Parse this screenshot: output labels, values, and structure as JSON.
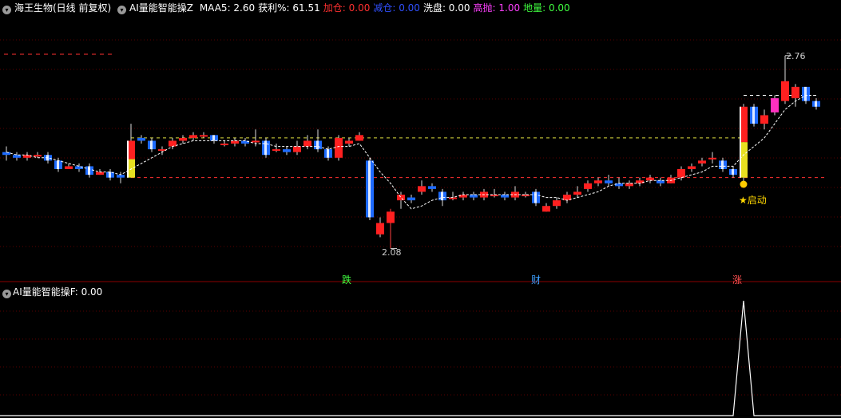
{
  "header": {
    "stock_title": "海王生物(日线 前复权)",
    "indicator_name": "AI量能智能操Z",
    "items": [
      {
        "label": "MAA5:",
        "value": "2.60",
        "color": "#ffffff"
      },
      {
        "label": "获利%:",
        "value": "61.51",
        "color": "#ffffff"
      },
      {
        "label": "加仓:",
        "value": "0.00",
        "color": "#ff3030"
      },
      {
        "label": "减仓:",
        "value": "0.00",
        "color": "#3050ff"
      },
      {
        "label": "洗盘:",
        "value": "0.00",
        "color": "#ffffff"
      },
      {
        "label": "高抛:",
        "value": "1.00",
        "color": "#ff40ff"
      },
      {
        "label": "地量:",
        "value": "0.00",
        "color": "#40ff40"
      }
    ]
  },
  "sub_header": {
    "indicator_name": "AI量能智能操F",
    "value": ": 0.00"
  },
  "labels": {
    "high": "2.76",
    "low": "2.08",
    "start": "启动",
    "signals": [
      {
        "text": "跌",
        "color": "#40ff40"
      },
      {
        "text": "财",
        "color": "#3da0ff"
      },
      {
        "text": "涨",
        "color": "#ff5050"
      }
    ]
  },
  "colors": {
    "up": "#ff2020",
    "down": "#1e6bff",
    "background": "#000000"
  },
  "chart_data": {
    "type": "candlestick",
    "title": "",
    "high_marker": 2.76,
    "low_marker": 2.08,
    "candles": [
      [
        2.42,
        2.41,
        2.44,
        2.39
      ],
      [
        2.41,
        2.4,
        2.42,
        2.39
      ],
      [
        2.4,
        2.41,
        2.42,
        2.39
      ],
      [
        2.41,
        2.41,
        2.42,
        2.4
      ],
      [
        2.41,
        2.39,
        2.42,
        2.38
      ],
      [
        2.39,
        2.36,
        2.4,
        2.35
      ],
      [
        2.36,
        2.37,
        2.38,
        2.36
      ],
      [
        2.37,
        2.36,
        2.38,
        2.35
      ],
      [
        2.37,
        2.34,
        2.38,
        2.33
      ],
      [
        2.34,
        2.35,
        2.36,
        2.34
      ],
      [
        2.35,
        2.33,
        2.36,
        2.32
      ],
      [
        2.34,
        2.33,
        2.35,
        2.31
      ],
      [
        2.33,
        2.46,
        2.52,
        2.33
      ],
      [
        2.47,
        2.46,
        2.48,
        2.45
      ],
      [
        2.46,
        2.43,
        2.47,
        2.42
      ],
      [
        2.43,
        2.43,
        2.44,
        2.41
      ],
      [
        2.44,
        2.46,
        2.47,
        2.43
      ],
      [
        2.46,
        2.47,
        2.48,
        2.45
      ],
      [
        2.47,
        2.48,
        2.49,
        2.46
      ],
      [
        2.48,
        2.48,
        2.49,
        2.47
      ],
      [
        2.48,
        2.46,
        2.48,
        2.45
      ],
      [
        2.45,
        2.45,
        2.46,
        2.44
      ],
      [
        2.45,
        2.46,
        2.47,
        2.44
      ],
      [
        2.46,
        2.45,
        2.47,
        2.44
      ],
      [
        2.46,
        2.46,
        2.5,
        2.44
      ],
      [
        2.46,
        2.41,
        2.47,
        2.4
      ],
      [
        2.43,
        2.43,
        2.45,
        2.42
      ],
      [
        2.43,
        2.42,
        2.44,
        2.41
      ],
      [
        2.42,
        2.44,
        2.46,
        2.41
      ],
      [
        2.44,
        2.46,
        2.48,
        2.43
      ],
      [
        2.46,
        2.43,
        2.5,
        2.42
      ],
      [
        2.43,
        2.4,
        2.44,
        2.39
      ],
      [
        2.4,
        2.47,
        2.48,
        2.39
      ],
      [
        2.45,
        2.46,
        2.47,
        2.44
      ],
      [
        2.46,
        2.48,
        2.49,
        2.46
      ],
      [
        2.39,
        2.19,
        2.4,
        2.18
      ],
      [
        2.13,
        2.17,
        2.19,
        2.12
      ],
      [
        2.17,
        2.21,
        2.22,
        2.08
      ],
      [
        2.25,
        2.27,
        2.28,
        2.22
      ],
      [
        2.26,
        2.25,
        2.27,
        2.24
      ],
      [
        2.28,
        2.3,
        2.32,
        2.27
      ],
      [
        2.3,
        2.29,
        2.31,
        2.28
      ],
      [
        2.28,
        2.25,
        2.29,
        2.23
      ],
      [
        2.26,
        2.26,
        2.28,
        2.25
      ],
      [
        2.26,
        2.27,
        2.28,
        2.25
      ],
      [
        2.27,
        2.26,
        2.28,
        2.25
      ],
      [
        2.26,
        2.28,
        2.29,
        2.25
      ],
      [
        2.27,
        2.27,
        2.29,
        2.26
      ],
      [
        2.27,
        2.26,
        2.28,
        2.25
      ],
      [
        2.26,
        2.28,
        2.3,
        2.25
      ],
      [
        2.27,
        2.27,
        2.28,
        2.26
      ],
      [
        2.28,
        2.24,
        2.29,
        2.23
      ],
      [
        2.21,
        2.23,
        2.24,
        2.21
      ],
      [
        2.23,
        2.25,
        2.26,
        2.22
      ],
      [
        2.25,
        2.27,
        2.28,
        2.24
      ],
      [
        2.27,
        2.28,
        2.3,
        2.26
      ],
      [
        2.29,
        2.31,
        2.32,
        2.28
      ],
      [
        2.31,
        2.32,
        2.33,
        2.3
      ],
      [
        2.32,
        2.31,
        2.34,
        2.3
      ],
      [
        2.31,
        2.3,
        2.33,
        2.29
      ],
      [
        2.3,
        2.31,
        2.32,
        2.29
      ],
      [
        2.31,
        2.32,
        2.33,
        2.3
      ],
      [
        2.32,
        2.33,
        2.34,
        2.31
      ],
      [
        2.32,
        2.31,
        2.33,
        2.3
      ],
      [
        2.31,
        2.33,
        2.34,
        2.31
      ],
      [
        2.33,
        2.36,
        2.37,
        2.32
      ],
      [
        2.36,
        2.37,
        2.38,
        2.35
      ],
      [
        2.38,
        2.39,
        2.4,
        2.37
      ],
      [
        2.4,
        2.4,
        2.42,
        2.38
      ],
      [
        2.39,
        2.36,
        2.4,
        2.35
      ],
      [
        2.36,
        2.34,
        2.37,
        2.33
      ],
      [
        2.33,
        2.58,
        2.59,
        2.31
      ],
      [
        2.58,
        2.52,
        2.59,
        2.51
      ],
      [
        2.52,
        2.55,
        2.57,
        2.5
      ],
      [
        2.56,
        2.61,
        2.62,
        2.55
      ],
      [
        2.6,
        2.67,
        2.76,
        2.59
      ],
      [
        2.61,
        2.65,
        2.66,
        2.58
      ],
      [
        2.65,
        2.6,
        2.64,
        2.59
      ],
      [
        2.6,
        2.58,
        2.61,
        2.57
      ]
    ],
    "ma": [
      2.42,
      2.41,
      2.41,
      2.4,
      2.4,
      2.39,
      2.38,
      2.37,
      2.36,
      2.35,
      2.35,
      2.34,
      2.36,
      2.38,
      2.4,
      2.42,
      2.44,
      2.45,
      2.46,
      2.46,
      2.46,
      2.46,
      2.46,
      2.46,
      2.45,
      2.45,
      2.44,
      2.44,
      2.44,
      2.44,
      2.44,
      2.43,
      2.44,
      2.44,
      2.45,
      2.4,
      2.35,
      2.31,
      2.26,
      2.22,
      2.23,
      2.25,
      2.26,
      2.26,
      2.27,
      2.27,
      2.27,
      2.27,
      2.27,
      2.27,
      2.27,
      2.27,
      2.26,
      2.26,
      2.25,
      2.26,
      2.27,
      2.28,
      2.3,
      2.31,
      2.31,
      2.31,
      2.32,
      2.32,
      2.32,
      2.33,
      2.34,
      2.35,
      2.37,
      2.37,
      2.37,
      2.41,
      2.44,
      2.47,
      2.52,
      2.57,
      2.6,
      2.62,
      2.62
    ],
    "h_lines": [
      {
        "value": 2.47,
        "color": "#e0e040"
      },
      {
        "value": 2.33,
        "color": "#ff3030"
      },
      {
        "value": 2.62,
        "color": "#ffffff"
      }
    ],
    "lower_panel": {
      "indicator": "AI量能智能操F",
      "values": [
        0,
        0,
        0,
        0,
        0,
        0,
        0,
        0,
        0,
        0,
        0,
        0,
        0,
        0,
        0,
        0,
        0,
        0,
        0,
        0,
        0,
        0,
        0,
        0,
        0,
        0,
        0,
        0,
        0,
        0,
        0,
        0,
        0,
        0,
        0,
        0,
        0,
        0,
        0,
        0,
        0,
        0,
        0,
        0,
        0,
        0,
        0,
        0,
        0,
        0,
        0,
        0,
        0,
        0,
        0,
        0,
        0,
        0,
        0,
        0,
        0,
        0,
        0,
        0,
        0,
        0,
        0,
        0,
        0,
        0,
        0,
        1,
        0,
        0,
        0,
        0,
        0,
        0,
        0
      ],
      "ylim": [
        0,
        1
      ]
    }
  }
}
